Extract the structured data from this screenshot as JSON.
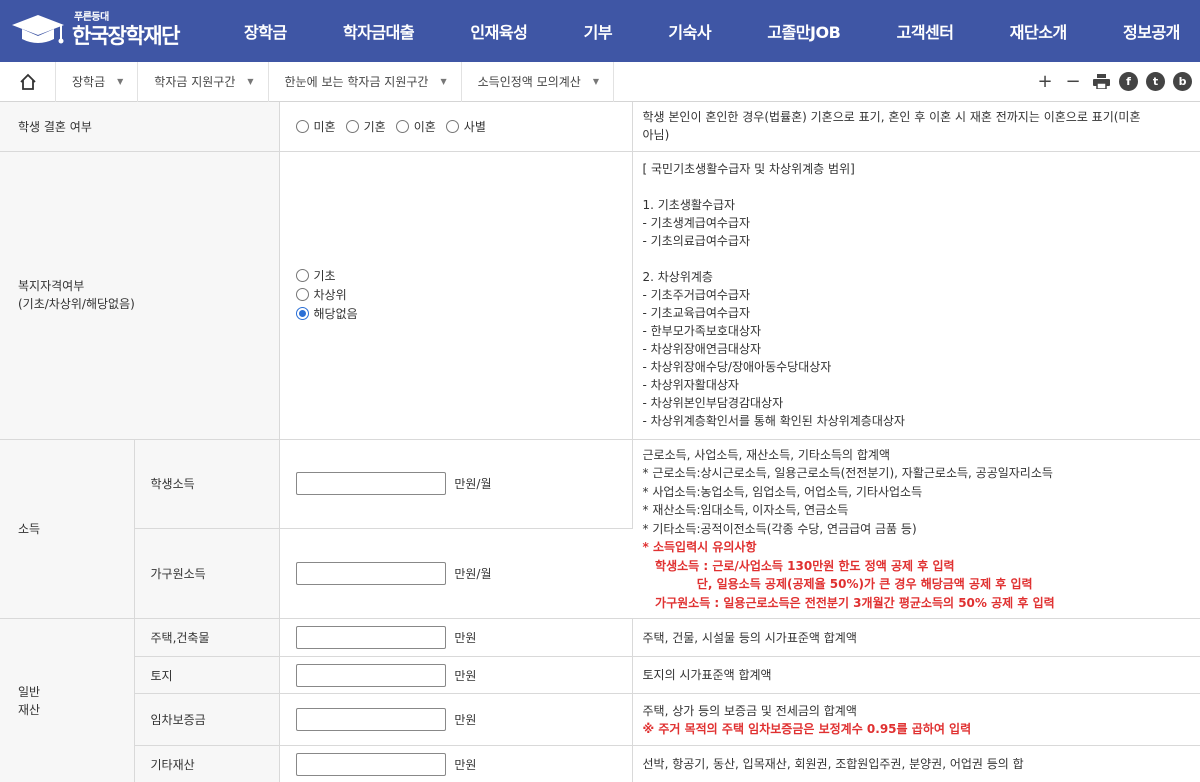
{
  "header": {
    "logo_sub": "푸른등대",
    "logo_main": "한국장학재단",
    "nav": [
      "장학금",
      "학자금대출",
      "인재육성",
      "기부",
      "기숙사",
      "고졸만JOB",
      "고객센터",
      "재단소개",
      "정보공개"
    ]
  },
  "breadcrumb": {
    "home_icon": "home-icon",
    "items": [
      "장학금",
      "학자금 지원구간",
      "한눈에 보는 학자금 지원구간",
      "소득인정액 모의계산"
    ],
    "tools": {
      "plus": "+",
      "minus": "−",
      "facebook": "f",
      "twitter": "t",
      "blog": "b"
    }
  },
  "form": {
    "marriage": {
      "label": "학생 결혼 여부",
      "options": [
        "미혼",
        "기혼",
        "이혼",
        "사별"
      ],
      "desc": [
        "학생 본인이 혼인한 경우(법률혼) 기혼으로 표기, 혼인 후 이혼 시 재혼 전까지는 이혼으로 표기(미혼",
        "아님)"
      ]
    },
    "welfare": {
      "label_1": "복지자격여부",
      "label_2": "(기초/차상위/해당없음)",
      "options": [
        "기초",
        "차상위",
        "해당없음"
      ],
      "selected": "해당없음",
      "desc": [
        "[ 국민기초생활수급자 및 차상위계층 범위]",
        "",
        "1. 기초생활수급자",
        " - 기초생계급여수급자",
        " - 기초의료급여수급자",
        "",
        "2. 차상위계층",
        " - 기초주거급여수급자",
        " - 기초교육급여수급자",
        " - 한부모가족보호대상자",
        " - 차상위장애연금대상자",
        " - 차상위장애수당/장애아동수당대상자",
        " - 차상위자활대상자",
        " - 차상위본인부담경감대상자",
        " - 차상위계층확인서를 통해 확인된 차상위계층대상자"
      ]
    },
    "income": {
      "label": "소득",
      "student_label": "학생소득",
      "family_label": "가구원소득",
      "unit": "만원/월",
      "desc": [
        "근로소득, 사업소득, 재산소득, 기타소득의 합계액",
        "* 근로소득:상시근로소득, 일용근로소득(전전분기), 자활근로소득, 공공일자리소득",
        "* 사업소득:농업소득, 임업소득, 어업소득, 기타사업소득",
        "* 재산소득:임대소득, 이자소득, 연금소득",
        "* 기타소득:공적이전소득(각종 수당, 연금급여 금품 등)"
      ],
      "notice": [
        "* 소득입력시 유의사항",
        "   학생소득 : 근로/사업소득 130만원 한도 정액 공제 후 입력",
        "             단, 일용소득 공제(공제율 50%)가 큰 경우 해당금액 공제 후 입력",
        "   가구원소득 : 일용근로소득은 전전분기 3개월간 평균소득의 50% 공제 후 입력"
      ]
    },
    "assets": {
      "label_1": "일반",
      "label_2": "재산",
      "unit": "만원",
      "rows": [
        {
          "label": "주택,건축물",
          "desc": "주택, 건물, 시설물 등의 시가표준액 합계액",
          "note": ""
        },
        {
          "label": "토지",
          "desc": "토지의 시가표준액 합계액",
          "note": ""
        },
        {
          "label": "임차보증금",
          "desc": "주택, 상가 등의 보증금 및 전세금의 합계액",
          "note": "※ 주거 목적의 주택 임차보증금은 보정계수 0.95를 곱하여 입력"
        },
        {
          "label": "기타재산",
          "desc": "선박, 항공기, 동산, 입목재산, 회원권, 조합원입주권, 분양권, 어업권 등의 합",
          "note": ""
        }
      ]
    }
  }
}
